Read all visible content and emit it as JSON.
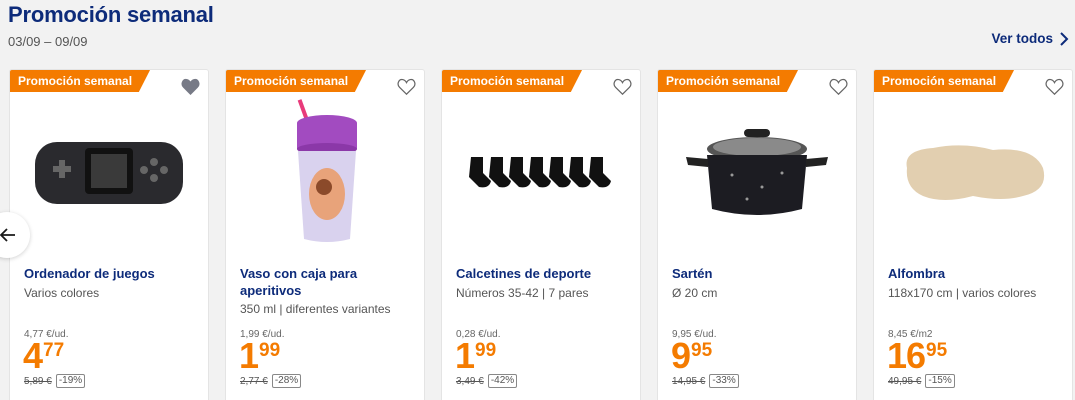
{
  "header": {
    "title": "Promoción semanal",
    "date_range": "03/09 – 09/09",
    "view_all_label": "Ver todos"
  },
  "colors": {
    "brand": "#0d2b7a",
    "accent": "#f47b00"
  },
  "products": [
    {
      "badge": "Promoción semanal",
      "favorited": true,
      "name": "Ordenador de juegos",
      "description": "Varios colores",
      "unit_price": "4,77 €/ud.",
      "price_int": "4",
      "price_dec": "77",
      "old_price": "5,89 €",
      "discount": "-19%",
      "image_icon": "handheld-console-icon"
    },
    {
      "badge": "Promoción semanal",
      "favorited": false,
      "name": "Vaso con caja para aperitivos",
      "description": "350 ml | diferentes variantes",
      "unit_price": "1,99 €/ud.",
      "price_int": "1",
      "price_dec": "99",
      "old_price": "2,77 €",
      "discount": "-28%",
      "image_icon": "snack-cup-icon"
    },
    {
      "badge": "Promoción semanal",
      "favorited": false,
      "name": "Calcetines de deporte",
      "description": "Números 35-42 | 7 pares",
      "unit_price": "0,28 €/ud.",
      "price_int": "1",
      "price_dec": "99",
      "old_price": "3,49 €",
      "discount": "-42%",
      "image_icon": "socks-icon"
    },
    {
      "badge": "Promoción semanal",
      "favorited": false,
      "name": "Sartén",
      "description": "Ø 20 cm",
      "unit_price": "9,95 €/ud.",
      "price_int": "9",
      "price_dec": "95",
      "old_price": "14,95 €",
      "discount": "-33%",
      "image_icon": "pot-icon"
    },
    {
      "badge": "Promoción semanal",
      "favorited": false,
      "name": "Alfombra",
      "description": "118x170 cm | varios colores",
      "unit_price": "8,45 €/m2",
      "price_int": "16",
      "price_dec": "95",
      "old_price": "49,95 €",
      "discount": "-15%",
      "image_icon": "rug-icon"
    }
  ],
  "carousel": {
    "prev_icon": "arrow-left-icon"
  }
}
